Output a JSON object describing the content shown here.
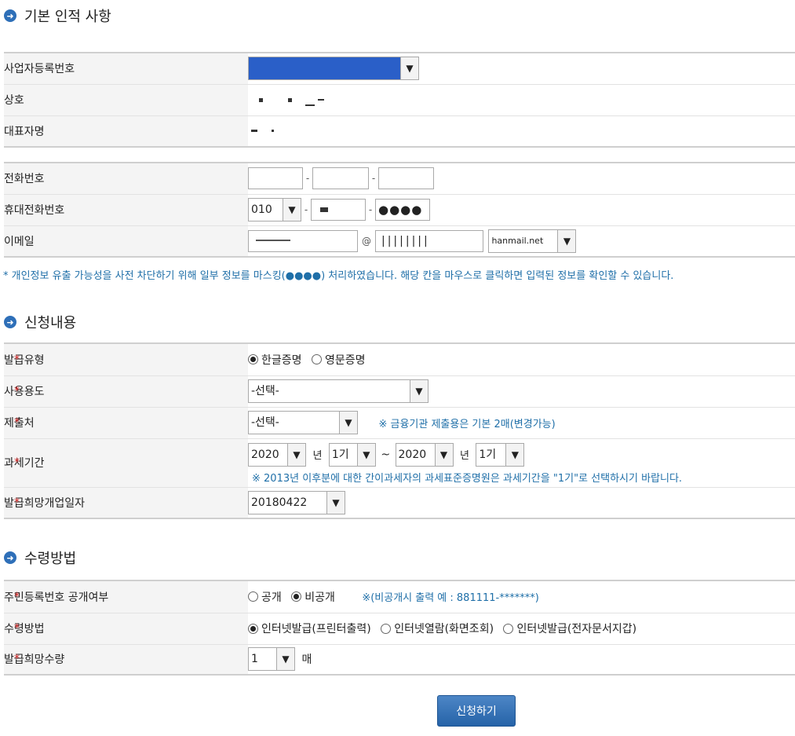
{
  "sections": {
    "basic": {
      "title": "기본 인적 사항"
    },
    "apply": {
      "title": "신청내용"
    },
    "receive": {
      "title": "수령방법"
    }
  },
  "basic": {
    "bizno_label": "사업자등록번호",
    "bizno_value": "",
    "company_label": "상호",
    "company_value": "",
    "ceo_label": "대표자명",
    "ceo_value": ""
  },
  "contact": {
    "phone_label": "전화번호",
    "phone1": "",
    "phone2": "",
    "phone3": "",
    "mobile_label": "휴대전화번호",
    "mobile_prefix": "010",
    "mobile_middle": "",
    "mobile_last": "●●●●",
    "email_label": "이메일",
    "email_id": "",
    "email_at": "@",
    "email_domain": "",
    "email_domain_select": "hanmail.net"
  },
  "privacy_note": "* 개인정보 유출 가능성을 사전 차단하기 위해 일부 정보를 마스킹(●●●●) 처리하였습니다. 해당 칸을 마우스로 클릭하면 입력된 정보를 확인할 수 있습니다.",
  "apply": {
    "required_mark": "*",
    "issue_type_label": "발급유형",
    "issue_type_options": [
      "한글증명",
      "영문증명"
    ],
    "issue_type_selected": "한글증명",
    "usage_label": "사용용도",
    "usage_value": "-선택-",
    "submit_to_label": "제출처",
    "submit_to_value": "-선택-",
    "submit_to_note": "※ 금융기관 제출용은 기본 2매(변경가능)",
    "period_label": "과세기간",
    "period_from_year": "2020",
    "period_year_unit": "년",
    "period_from_half": "1기",
    "period_tilde": "~",
    "period_to_year": "2020",
    "period_to_half": "1기",
    "period_note": "※ 2013년 이후분에 대한 간이과세자의 과세표준증명원은 과세기간을 \"1기\"로 선택하시기 바랍니다.",
    "open_date_label": "발급희망개업일자",
    "open_date_value": "20180422"
  },
  "receive": {
    "rrn_label": "주민등록번호 공개여부",
    "rrn_options": [
      "공개",
      "비공개"
    ],
    "rrn_selected": "비공개",
    "rrn_note": "※(비공개시 출력 예 : 881111-*******)",
    "method_label": "수령방법",
    "method_options": [
      "인터넷발급(프린터출력)",
      "인터넷열람(화면조회)",
      "인터넷발급(전자문서지갑)"
    ],
    "method_selected": "인터넷발급(프린터출력)",
    "qty_label": "발급희망수량",
    "qty_value": "1",
    "qty_unit": "매"
  },
  "submit_label": "신청하기",
  "colors": {
    "accent": "#2e6fb8",
    "note": "#1f6fa8",
    "required": "#d02020",
    "button": "#2563a8"
  }
}
